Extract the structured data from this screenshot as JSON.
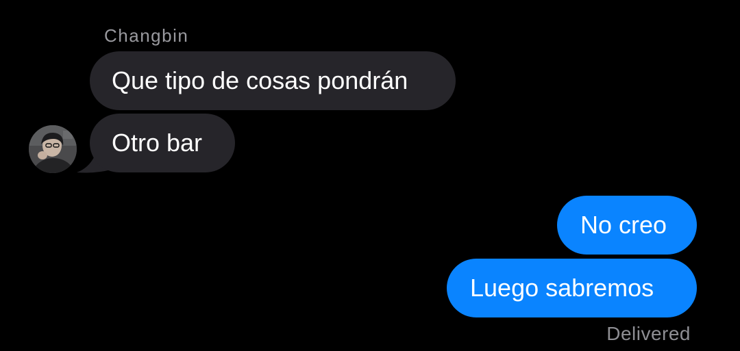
{
  "conversation": {
    "sender_name": "Changbin",
    "messages": [
      {
        "direction": "incoming",
        "text": "Que tipo de cosas pondrán"
      },
      {
        "direction": "incoming",
        "text": "Otro bar"
      },
      {
        "direction": "outgoing",
        "text": "No creo"
      },
      {
        "direction": "outgoing",
        "text": "Luego sabremos"
      }
    ],
    "status": "Delivered"
  },
  "colors": {
    "background": "#000000",
    "incoming_bubble": "#26252a",
    "outgoing_bubble": "#0a84ff",
    "text": "#ffffff",
    "secondary_text": "#8e8e93"
  },
  "icons": {
    "avatar": "contact-photo"
  }
}
